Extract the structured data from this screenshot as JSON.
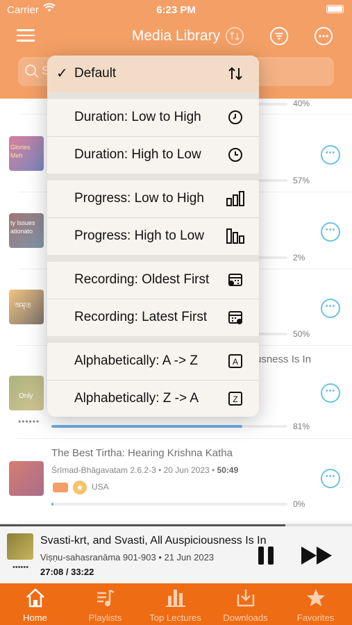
{
  "status": {
    "carrier": "Carrier",
    "time": "6:23 PM"
  },
  "header": {
    "title": "Media Library",
    "search_placeholder": "S"
  },
  "sort_menu": {
    "selected": "Default",
    "items": [
      {
        "label": "Default",
        "icon": "sort-arrows-icon",
        "checked": true
      },
      {
        "label": "Duration: Low to High",
        "icon": "clock-icon"
      },
      {
        "label": "Duration: High to Low",
        "icon": "clock-icon"
      },
      {
        "label": "Progress: Low to High",
        "icon": "bars-ascending-icon"
      },
      {
        "label": "Progress: High to Low",
        "icon": "bars-descending-icon"
      },
      {
        "label": "Recording: Oldest First",
        "icon": "calendar-icon"
      },
      {
        "label": "Recording: Latest First",
        "icon": "calendar-icon"
      },
      {
        "label": "Alphabetically: A -> Z",
        "icon": "letter-a-icon"
      },
      {
        "label": "Alphabetically: Z -> A",
        "icon": "letter-z-icon"
      }
    ]
  },
  "list": {
    "rows": [
      {
        "progress": 40,
        "progress_label": "40%"
      },
      {
        "thumb_text": "Glories Meh",
        "progress": 57,
        "progress_label": "57%"
      },
      {
        "thumb_text": "ty Issues ationato",
        "progress": 2,
        "progress_label": "2%"
      },
      {
        "thumb_text": "অমৃত",
        "progress": 50,
        "progress_label": "50%"
      },
      {
        "title_fragment": "usness Is In",
        "thumb_text": "Only",
        "progress": 81,
        "progress_label": "81%",
        "dots": "••••••"
      },
      {
        "title": "The Best Tirtha: Hearing Krishna Katha",
        "source": "Śrīmad-Bhāgavatam 2.6.2-3",
        "date": "20 Jun 2023",
        "duration": "50:49",
        "location": "USA",
        "progress": 0,
        "progress_label": "0%"
      }
    ]
  },
  "player": {
    "title": "Svasti-krt, and Svasti, All Auspiciousness Is In",
    "source": "Viṣṇu-sahasranāma 901-903",
    "date": "21 Jun 2023",
    "elapsed": "27:08",
    "total": "33:22",
    "time_display": "27:08 / 33:22",
    "dots": "••••••",
    "progress": 81
  },
  "tabs": [
    {
      "label": "Home",
      "icon": "home-icon",
      "active": true
    },
    {
      "label": "Playlists",
      "icon": "playlist-icon"
    },
    {
      "label": "Top Lectures",
      "icon": "chart-icon"
    },
    {
      "label": "Downloads",
      "icon": "download-icon"
    },
    {
      "label": "Favorites",
      "icon": "star-icon"
    }
  ],
  "colors": {
    "brand": "#ee6c14",
    "accent": "#1ea1d6",
    "progress": "#1f82d2"
  }
}
